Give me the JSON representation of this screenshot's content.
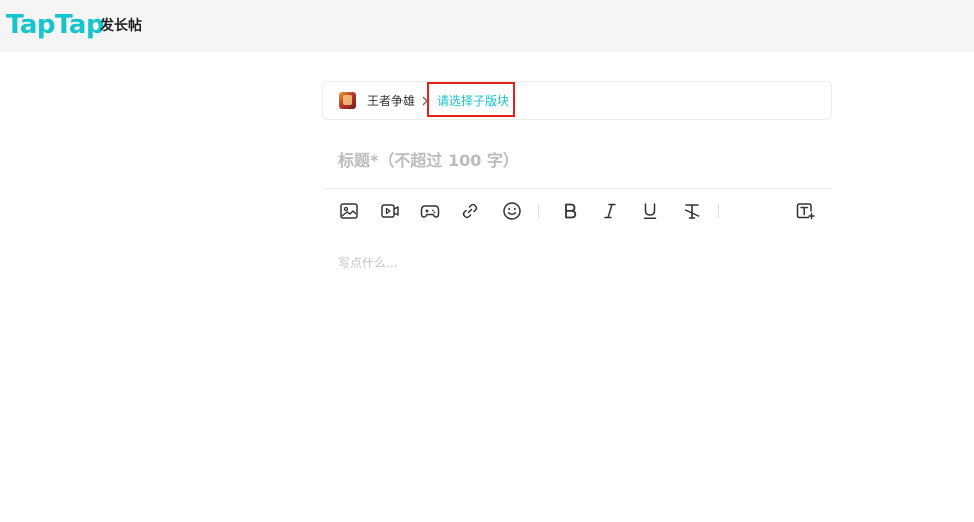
{
  "header": {
    "logo_text": "TapTap",
    "page_title": "发长帖"
  },
  "breadcrumb": {
    "game_name": "王者争雄",
    "subforum_placeholder": "请选择子版块"
  },
  "editor": {
    "title_placeholder": "标题*（不超过 100 字）",
    "content_placeholder": "写点什么..."
  },
  "toolbar": {
    "tools": [
      "image",
      "video",
      "game",
      "link",
      "emoji",
      "bold",
      "italic",
      "underline",
      "clear-format",
      "text-style"
    ]
  },
  "colors": {
    "brand": "#15c5ce",
    "highlight": "#e2231a",
    "topbar": "#f5f5f5"
  }
}
